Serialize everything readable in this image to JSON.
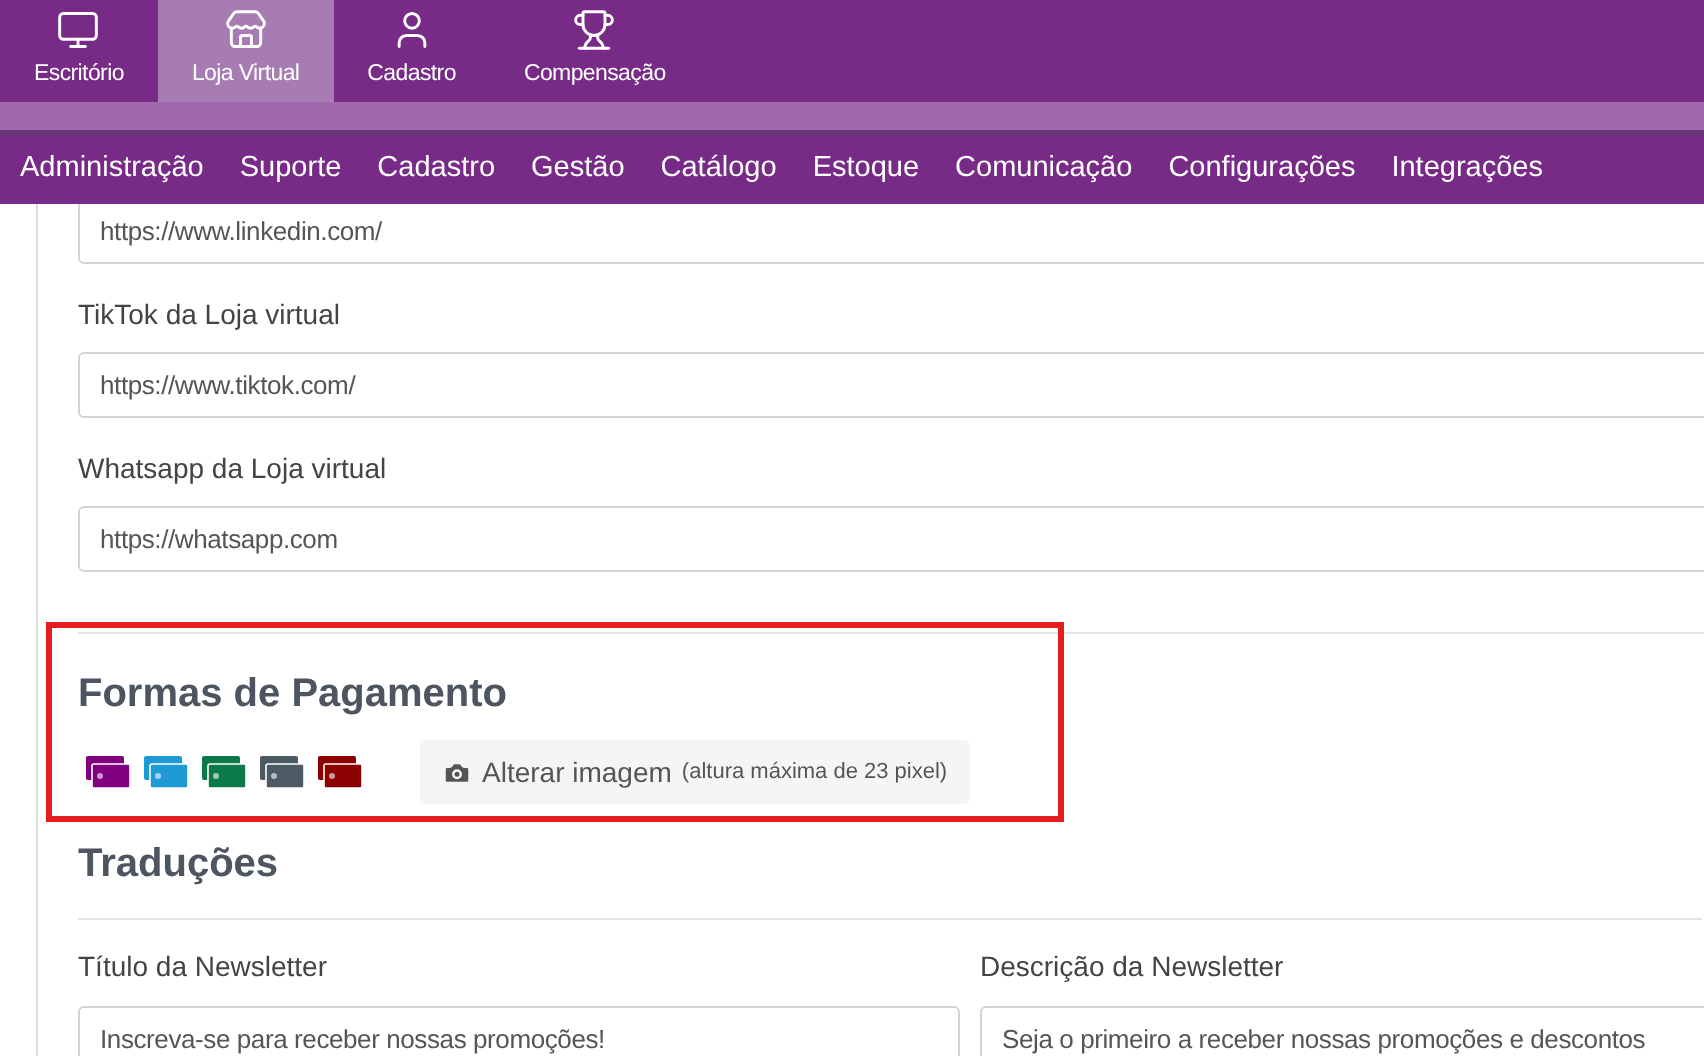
{
  "top_tabs": [
    {
      "label": "Escritório",
      "kind": "desk",
      "selected": false
    },
    {
      "label": "Loja Virtual",
      "kind": "shop",
      "selected": true
    },
    {
      "label": "Cadastro",
      "kind": "register",
      "selected": false
    },
    {
      "label": "Compensação",
      "kind": "bonus",
      "selected": false
    }
  ],
  "menu": [
    "Administração",
    "Suporte",
    "Cadastro",
    "Gestão",
    "Catálogo",
    "Estoque",
    "Comunicação",
    "Configurações",
    "Integrações"
  ],
  "social_fields": [
    {
      "value": "https://www.linkedin.com/"
    },
    {
      "label": "TikTok da Loja virtual",
      "value": "https://www.tiktok.com/"
    },
    {
      "label": "Whatsapp da Loja virtual",
      "value": "https://whatsapp.com"
    }
  ],
  "payment": {
    "title": "Formas de Pagamento",
    "cards": [
      {
        "color": "#800080"
      },
      {
        "color": "#1e9bd7"
      },
      {
        "color": "#0b7a4b"
      },
      {
        "color": "#4b5a63"
      },
      {
        "color": "#8b0000"
      }
    ],
    "button": "Alterar imagem",
    "button_note": "(altura máxima de 23 pixel)"
  },
  "translations": {
    "title": "Traduções",
    "fields": [
      {
        "label": "Título da Newsletter",
        "value": "Inscreva-se para receber nossas promoções!"
      },
      {
        "label": "Descrição da Newsletter",
        "value": "Seja o primeiro a receber nossas promoções e descontos"
      }
    ]
  }
}
